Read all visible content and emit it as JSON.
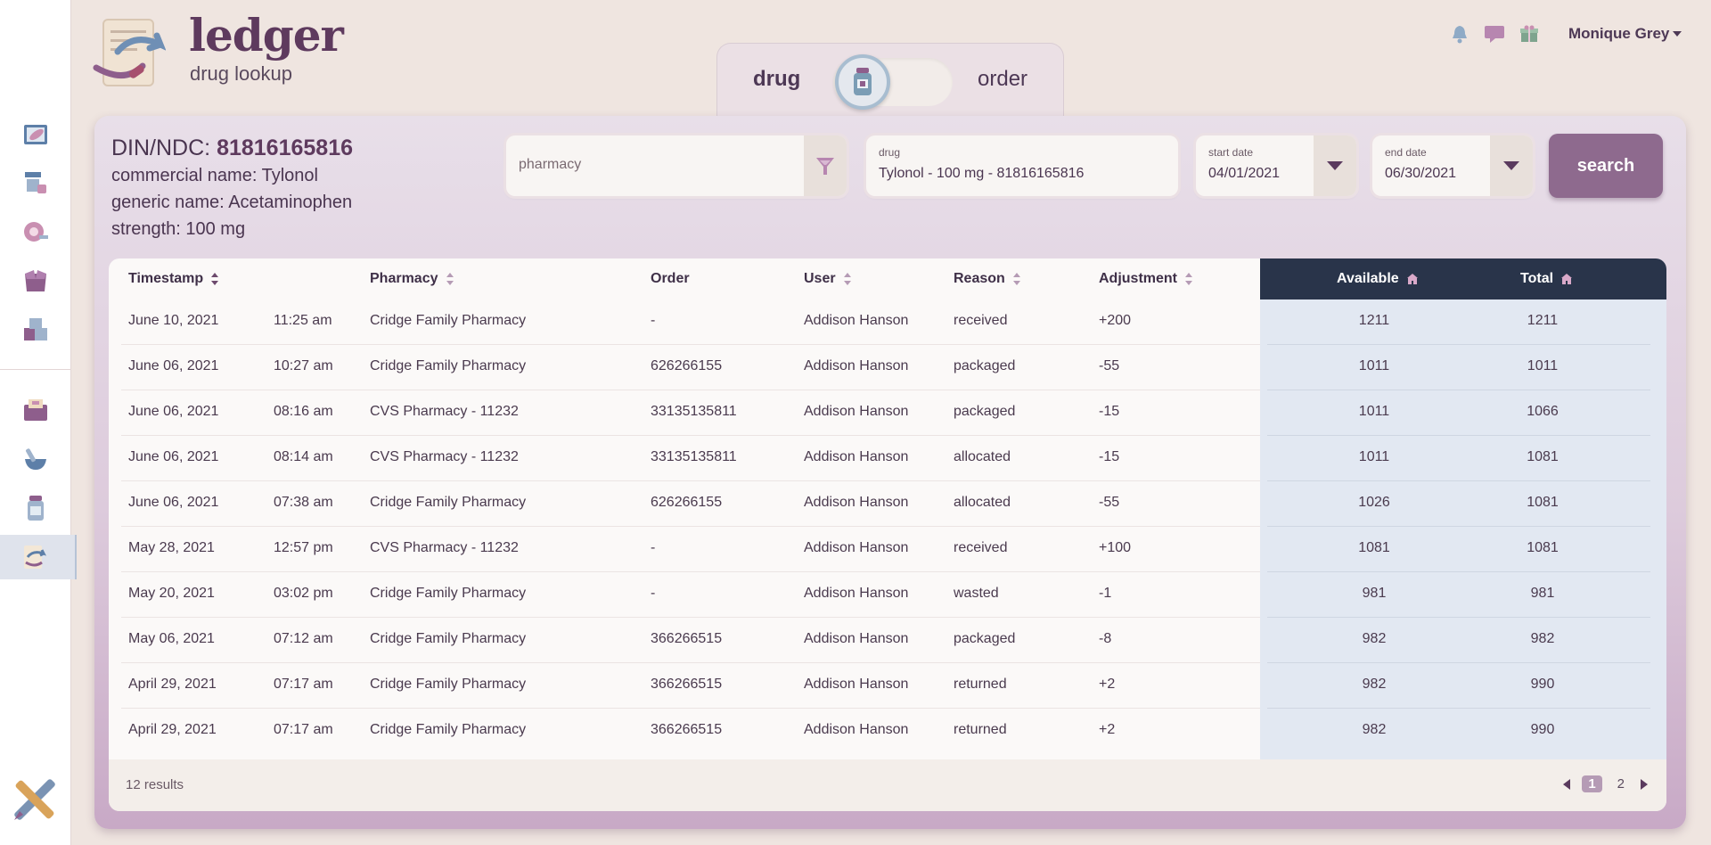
{
  "brand": {
    "title": "ledger",
    "subtitle": "drug lookup"
  },
  "mode_toggle": {
    "left_label": "drug",
    "right_label": "order",
    "active": "drug"
  },
  "header": {
    "user_name": "Monique Grey"
  },
  "sidebar": {
    "items": [
      {
        "icon": "pill-box-icon"
      },
      {
        "icon": "pharmacy-shelf-icon"
      },
      {
        "icon": "tape-roll-icon"
      },
      {
        "icon": "open-box-icon"
      },
      {
        "icon": "stacked-boxes-icon"
      },
      {
        "icon": "folder-pills-icon"
      },
      {
        "icon": "mortar-pestle-icon"
      },
      {
        "icon": "medicine-bottle-icon"
      },
      {
        "icon": "ledger-exchange-icon",
        "active": true
      }
    ]
  },
  "drug_info": {
    "din_label": "DIN/NDC: ",
    "din_value": "81816165816",
    "commercial_name": "commercial name: Tylonol",
    "generic_name": "generic name: Acetaminophen",
    "strength": "strength: 100 mg"
  },
  "filters": {
    "pharmacy_placeholder": "pharmacy",
    "drug_caption": "drug",
    "drug_value": "Tylonol - 100 mg - 81816165816",
    "start_caption": "start date",
    "start_value": "04/01/2021",
    "end_caption": "end date",
    "end_value": "06/30/2021",
    "search_label": "search"
  },
  "table": {
    "headers": {
      "timestamp": "Timestamp",
      "pharmacy": "Pharmacy",
      "order": "Order",
      "user": "User",
      "reason": "Reason",
      "adjustment": "Adjustment",
      "available": "Available",
      "total": "Total"
    },
    "rows": [
      {
        "date": "June 10, 2021",
        "time": "11:25 am",
        "pharmacy": "Cridge Family Pharmacy",
        "order": "-",
        "user": "Addison Hanson",
        "reason": "received",
        "adjustment": "+200",
        "available": "1211",
        "total": "1211"
      },
      {
        "date": "June 06, 2021",
        "time": "10:27 am",
        "pharmacy": "Cridge Family Pharmacy",
        "order": "626266155",
        "user": "Addison Hanson",
        "reason": "packaged",
        "adjustment": "-55",
        "available": "1011",
        "total": "1011"
      },
      {
        "date": "June 06, 2021",
        "time": "08:16 am",
        "pharmacy": "CVS Pharmacy - 11232",
        "order": "33135135811",
        "user": "Addison Hanson",
        "reason": "packaged",
        "adjustment": "-15",
        "available": "1011",
        "total": "1066"
      },
      {
        "date": "June 06, 2021",
        "time": "08:14 am",
        "pharmacy": "CVS Pharmacy - 11232",
        "order": "33135135811",
        "user": "Addison Hanson",
        "reason": "allocated",
        "adjustment": "-15",
        "available": "1011",
        "total": "1081"
      },
      {
        "date": "June 06, 2021",
        "time": "07:38 am",
        "pharmacy": "Cridge Family Pharmacy",
        "order": "626266155",
        "user": "Addison Hanson",
        "reason": "allocated",
        "adjustment": "-55",
        "available": "1026",
        "total": "1081"
      },
      {
        "date": "May 28, 2021",
        "time": "12:57 pm",
        "pharmacy": "CVS Pharmacy - 11232",
        "order": "-",
        "user": "Addison Hanson",
        "reason": "received",
        "adjustment": "+100",
        "available": "1081",
        "total": "1081"
      },
      {
        "date": "May 20, 2021",
        "time": "03:02 pm",
        "pharmacy": "Cridge Family Pharmacy",
        "order": "-",
        "user": "Addison Hanson",
        "reason": "wasted",
        "adjustment": "-1",
        "available": "981",
        "total": "981"
      },
      {
        "date": "May 06, 2021",
        "time": "07:12 am",
        "pharmacy": "Cridge Family Pharmacy",
        "order": "366266515",
        "user": "Addison Hanson",
        "reason": "packaged",
        "adjustment": "-8",
        "available": "982",
        "total": "982"
      },
      {
        "date": "April 29, 2021",
        "time": "07:17 am",
        "pharmacy": "Cridge Family Pharmacy",
        "order": "366266515",
        "user": "Addison Hanson",
        "reason": "returned",
        "adjustment": "+2",
        "available": "982",
        "total": "990"
      },
      {
        "date": "April 29, 2021",
        "time": "07:17 am",
        "pharmacy": "Cridge Family Pharmacy",
        "order": "366266515",
        "user": "Addison Hanson",
        "reason": "returned",
        "adjustment": "+2",
        "available": "982",
        "total": "990"
      }
    ]
  },
  "footer": {
    "results_text": "12 results",
    "pages": [
      "1",
      "2"
    ],
    "current_page": "1"
  },
  "colors": {
    "brand_purple": "#5e3a5e",
    "button_purple": "#8e6a8e",
    "dark_header": "#29344a",
    "right_panel": "#e2e8f2"
  }
}
